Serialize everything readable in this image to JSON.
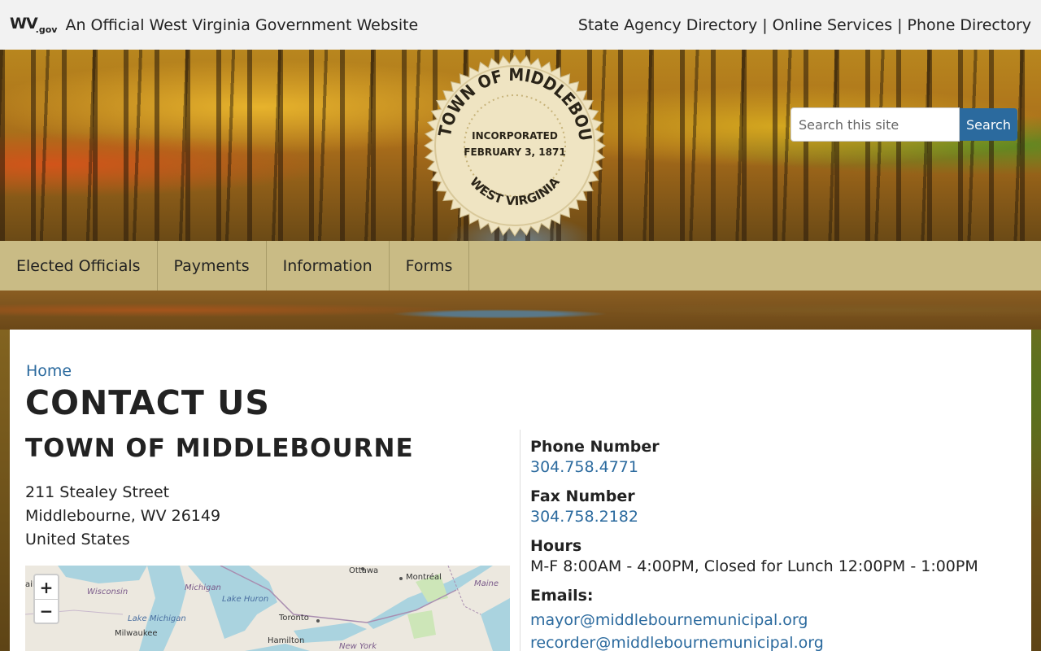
{
  "topbar": {
    "logo_main": "WV",
    "logo_suffix": ".gov",
    "official_text": "An Official West Virginia Government Website",
    "links": [
      "State Agency Directory",
      "Online Services",
      "Phone Directory"
    ],
    "separator": "|"
  },
  "seal": {
    "top_text": "THE TOWN OF MIDDLEBOURNE",
    "line1": "INCORPORATED",
    "line2": "FEBRUARY 3, 1871",
    "bottom_text": "WEST VIRGINIA"
  },
  "search": {
    "placeholder": "Search this site",
    "button_label": "Search"
  },
  "nav": {
    "items": [
      "Elected Officials",
      "Payments",
      "Information",
      "Forms"
    ]
  },
  "breadcrumb": {
    "home": "Home"
  },
  "page": {
    "title": "CONTACT US"
  },
  "organization": {
    "name": "TOWN OF MIDDLEBOURNE",
    "street": "211 Stealey Street",
    "city_line": "Middlebourne, WV 26149",
    "country": "United States"
  },
  "map": {
    "zoom_in": "+",
    "zoom_out": "−",
    "labels": {
      "ottawa": "Ottawa",
      "montreal": "Montréal",
      "maine": "Maine",
      "wisconsin": "Wisconsin",
      "michigan": "Michigan",
      "lake_huron": "Lake Huron",
      "lake_michigan": "Lake Michigan",
      "toronto": "Toronto",
      "milwaukee": "Milwaukee",
      "hamilton": "Hamilton",
      "new_york": "New York",
      "partial_left": "ail"
    }
  },
  "contact": {
    "phone_label": "Phone Number",
    "phone": "304.758.4771",
    "fax_label": "Fax Number",
    "fax": "304.758.2182",
    "hours_label": "Hours",
    "hours": "M-F 8:00AM - 4:00PM, Closed for Lunch 12:00PM - 1:00PM",
    "emails_label": "Emails:",
    "emails": [
      "mayor@middlebournemunicipal.org",
      "recorder@middlebournemunicipal.org"
    ]
  },
  "colors": {
    "link": "#2b6a9e",
    "nav_bg": "#c9bb85",
    "topbar_bg": "#f2f2f2",
    "search_button": "#2b6a9e",
    "seal_fill": "#efe4c2"
  }
}
